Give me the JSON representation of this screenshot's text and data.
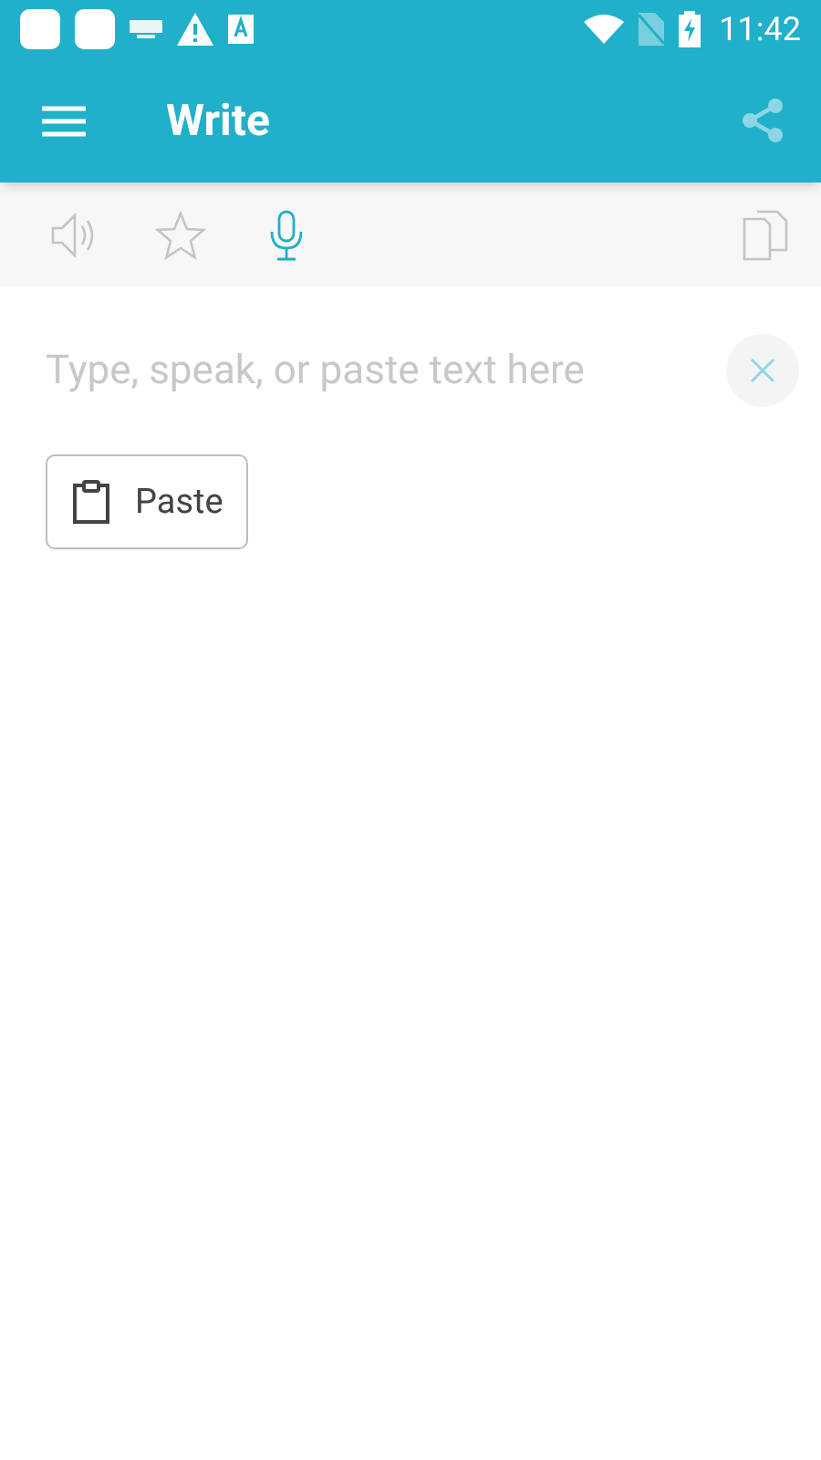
{
  "status_bar": {
    "time": "11:42"
  },
  "app_bar": {
    "title": "Write"
  },
  "toolbar": [
    {
      "kind": "speaker",
      "active": false
    },
    {
      "kind": "star",
      "active": false
    },
    {
      "kind": "mic",
      "active": true
    }
  ],
  "editor": {
    "placeholder": "Type, speak, or paste text here"
  },
  "paste_button": {
    "label": "Paste"
  }
}
